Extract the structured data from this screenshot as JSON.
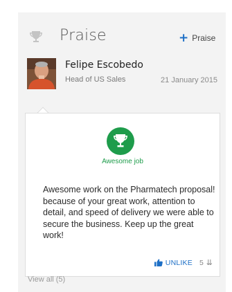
{
  "header": {
    "title": "Praise",
    "add_label": "Praise",
    "add_icon": "plus-icon",
    "title_icon": "trophy-icon"
  },
  "person": {
    "name": "Felipe Escobedo",
    "role": "Head of US Sales",
    "date": "21 January 2015"
  },
  "badge": {
    "icon": "trophy-icon",
    "label": "Awesome job",
    "color": "#1e9c4b"
  },
  "message": "Awesome work on the Pharmatech proposal!  because of your great work, attention to detail, and speed of delivery we were able to secure the business. Keep up the great work!",
  "actions": {
    "unlike_label": "UNLIKE",
    "like_count": "5",
    "expand_icon": "double-chevron-down-icon"
  },
  "footer": {
    "view_all": "View all (5)"
  },
  "colors": {
    "accent": "#1d6fc6",
    "badge_green": "#1e9c4b",
    "panel_bg": "#f3f3f3"
  }
}
